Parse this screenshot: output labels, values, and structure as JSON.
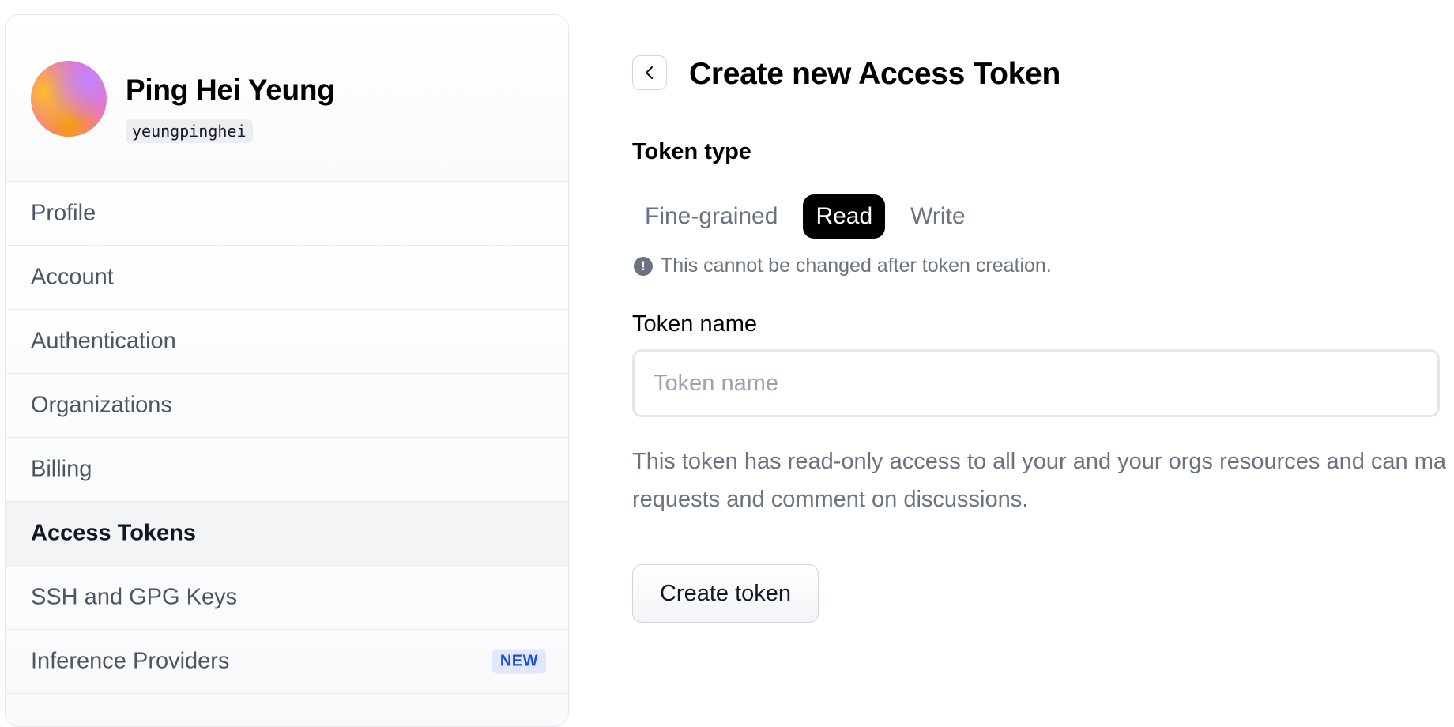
{
  "user": {
    "name": "Ping Hei Yeung",
    "handle": "yeungpinghei"
  },
  "sidebar": {
    "items": [
      {
        "label": "Profile",
        "active": false
      },
      {
        "label": "Account",
        "active": false
      },
      {
        "label": "Authentication",
        "active": false
      },
      {
        "label": "Organizations",
        "active": false
      },
      {
        "label": "Billing",
        "active": false
      },
      {
        "label": "Access Tokens",
        "active": true
      },
      {
        "label": "SSH and GPG Keys",
        "active": false
      },
      {
        "label": "Inference Providers",
        "active": false,
        "badge": "NEW"
      }
    ]
  },
  "main": {
    "back_icon": "chevron-left-icon",
    "title": "Create new Access Token",
    "token_type": {
      "label": "Token type",
      "options": [
        "Fine-grained",
        "Read",
        "Write"
      ],
      "selected": "Read",
      "warning": "This cannot be changed after token creation.",
      "warning_icon": "exclamation-circle-icon"
    },
    "token_name": {
      "label": "Token name",
      "placeholder": "Token name",
      "value": ""
    },
    "description_line1": "This token has read-only access to all your and your orgs resources and can ma",
    "description_line2": "requests and comment on discussions.",
    "create_button_label": "Create token"
  },
  "colors": {
    "selected_segment": "#000000",
    "badge_bg": "#e0e7ff",
    "badge_text": "#1d4ed8",
    "muted_text": "#6b7280"
  }
}
